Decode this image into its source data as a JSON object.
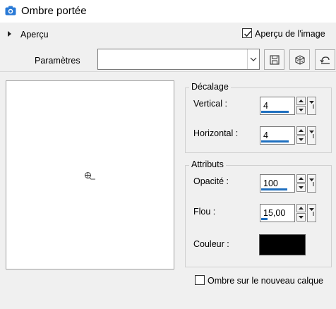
{
  "window": {
    "title": "Ombre portée",
    "icon": "camera-icon"
  },
  "preview_section": {
    "label": "Aperçu",
    "checkbox_label": "Aperçu de l'image",
    "checkbox_checked": true
  },
  "presets": {
    "label": "Paramètres",
    "value": "",
    "buttons": [
      "save-preset-icon",
      "random-dice-icon",
      "reset-icon"
    ]
  },
  "offset": {
    "title": "Décalage",
    "vertical": {
      "label": "Vertical :",
      "value": "4",
      "level": 0.85
    },
    "horizontal": {
      "label": "Horizontal :",
      "value": "4",
      "level": 0.85
    }
  },
  "attributes": {
    "title": "Attributs",
    "opacity": {
      "label": "Opacité :",
      "value": "100",
      "level": 0.8
    },
    "blur": {
      "label": "Flou :",
      "value": "15,00",
      "level": 0.2
    },
    "color": {
      "label": "Couleur :",
      "value": "#000000"
    }
  },
  "new_layer": {
    "label": "Ombre sur le nouveau calque",
    "checked": false
  },
  "colors": {
    "accent": "#1f6fbf",
    "icon_blue": "#2a7ad6"
  }
}
